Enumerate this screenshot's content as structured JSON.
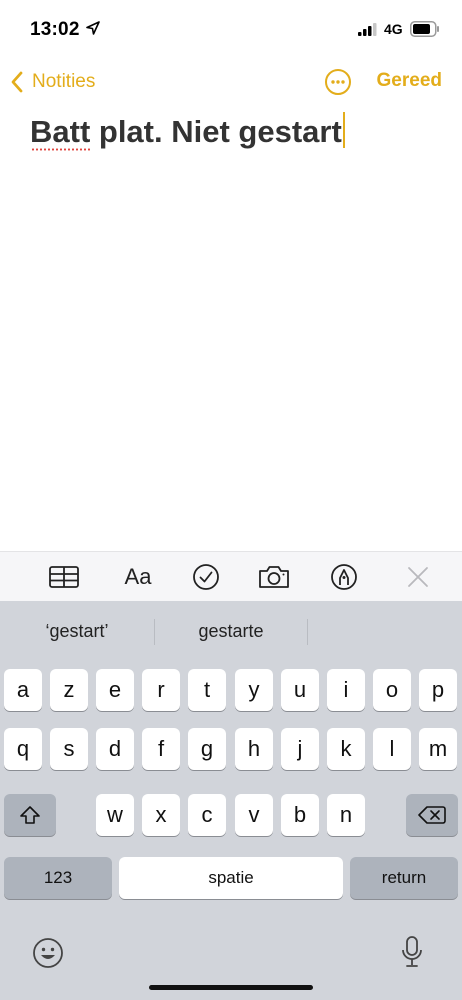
{
  "status_bar": {
    "time": "13:02",
    "network": "4G",
    "location_icon": "location-arrow-icon",
    "signal_icon": "signal-bars-icon",
    "battery_icon": "battery-icon"
  },
  "nav": {
    "back_label": "Notities",
    "done_label": "Gereed",
    "more_icon": "ellipsis-circle-icon",
    "accent_color": "#e3ad1b"
  },
  "note": {
    "text": "Batt plat. Niet gestart",
    "misspelled_word": "Batt"
  },
  "format_toolbar": {
    "format_label": "Aa",
    "icons": [
      "table-icon",
      "text-format-icon",
      "checklist-icon",
      "camera-icon",
      "markup-pen-icon",
      "close-icon"
    ]
  },
  "keyboard": {
    "suggestions": [
      "‘gestart’",
      "gestarte",
      ""
    ],
    "rows": [
      [
        "a",
        "z",
        "e",
        "r",
        "t",
        "y",
        "u",
        "i",
        "o",
        "p"
      ],
      [
        "q",
        "s",
        "d",
        "f",
        "g",
        "h",
        "j",
        "k",
        "l",
        "m"
      ],
      [
        "w",
        "x",
        "c",
        "v",
        "b",
        "n"
      ]
    ],
    "numbers_label": "123",
    "space_label": "spatie",
    "return_label": "return",
    "shift_icon": "shift-icon",
    "delete_icon": "backspace-icon",
    "emoji_icon": "emoji-icon",
    "mic_icon": "microphone-icon"
  }
}
